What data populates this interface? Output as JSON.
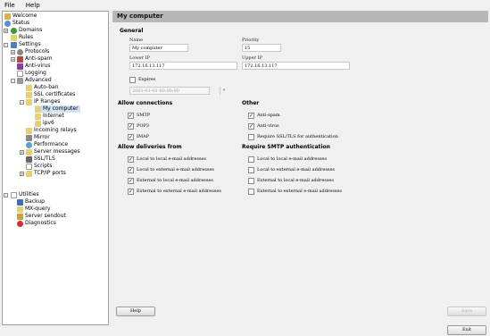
{
  "menu": {
    "file": "File",
    "help": "Help"
  },
  "tree": {
    "welcome": "Welcome",
    "status": "Status",
    "domains": "Domains",
    "rules": "Rules",
    "settings": "Settings",
    "protocols": "Protocols",
    "antispam": "Anti-spam",
    "antivirus": "Anti-virus",
    "logging": "Logging",
    "advanced": "Advanced",
    "autoban": "Auto-ban",
    "ssl_certs": "SSL certificates",
    "ip_ranges": "IP Ranges",
    "my_computer": "My computer",
    "internet": "Internet",
    "ipv6": "ipv6",
    "incoming_relays": "Incoming relays",
    "mirror": "Mirror",
    "performance": "Performance",
    "server_messages": "Server messages",
    "ssl_tls": "SSL/TLS",
    "scripts": "Scripts",
    "tcpip_ports": "TCP/IP ports",
    "utilities": "Utilities",
    "backup": "Backup",
    "mx_query": "MX-query",
    "server_sendout": "Server sendout",
    "diagnostics": "Diagnostics"
  },
  "page": {
    "title": "My computer",
    "general": "General",
    "name_label": "Name",
    "name_value": "My computer",
    "priority_label": "Priority",
    "priority_value": "15",
    "lower_ip_label": "Lower IP",
    "lower_ip_value": "172.16.13.117",
    "upper_ip_label": "Upper IP",
    "upper_ip_value": "172.16.13.117",
    "expires_label": "Expires",
    "expires_value": "2001-01-01 00:00:00",
    "allow_connections": "Allow connections",
    "smtp": "SMTP",
    "pop3": "POP3",
    "imap": "IMAP",
    "other": "Other",
    "anti_spam": "Anti-spam",
    "anti_virus": "Anti-virus",
    "require_ssl": "Require SSL/TLS for authentication",
    "allow_deliveries": "Allow deliveries from",
    "require_smtp_auth": "Require SMTP authentication",
    "d_local_local": "Local to local e-mail addresses",
    "d_local_external": "Local to external e-mail addresses",
    "d_external_local": "External to local e-mail addresses",
    "d_external_external": "External to external e-mail addresses"
  },
  "buttons": {
    "help": "Help",
    "save": "Save",
    "exit": "Exit"
  },
  "colors": {
    "header_bg": "#b7b7b7",
    "selection": "#cfe2f7"
  }
}
